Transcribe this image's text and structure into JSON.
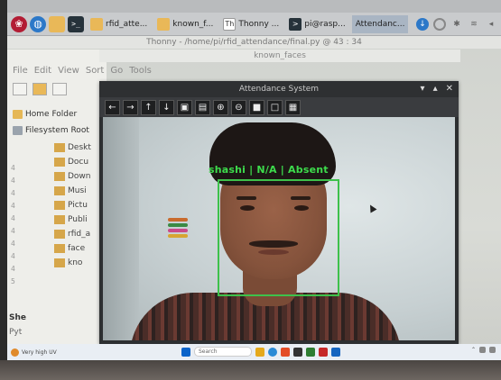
{
  "pi_taskbar": {
    "tasks": [
      {
        "label": "rfid_atte..."
      },
      {
        "label": "known_f..."
      },
      {
        "label": "Thonny ..."
      },
      {
        "label": "pi@rasp..."
      },
      {
        "label": "Attendanc..."
      }
    ]
  },
  "thonny": {
    "title": "Thonny - /home/pi/rfid_attendance/final.py @ 43 : 34"
  },
  "file_manager": {
    "title": "known_faces",
    "menu": [
      "File",
      "Edit",
      "View",
      "Sort",
      "Go",
      "Tools"
    ],
    "sidebar": [
      {
        "label": "Home Folder"
      },
      {
        "label": "Filesystem Root"
      }
    ],
    "tree": [
      "Deskt",
      "Docu",
      "Down",
      "Musi",
      "Pictu",
      "Publi",
      "rfid_a",
      "face",
      "kno"
    ],
    "line_numbers": [
      "4",
      "4",
      "4",
      "4",
      "4",
      "4",
      "4",
      "4",
      "4",
      "5"
    ],
    "shell_label": "She",
    "shell_prompt": "Pyt"
  },
  "attendance_window": {
    "title": "Attendance System",
    "controls": [
      "▾",
      "▴",
      "✕"
    ],
    "toolbar": [
      "←",
      "→",
      "↑",
      "↓",
      "▣",
      "▤",
      "⊕",
      "⊖",
      "■",
      "□",
      "▦"
    ],
    "detection_label": "shashi | N/A | Absent"
  },
  "win_taskbar": {
    "weather": "Very high UV",
    "search": "Search",
    "colors": {
      "accent": "#0a63c9"
    }
  }
}
